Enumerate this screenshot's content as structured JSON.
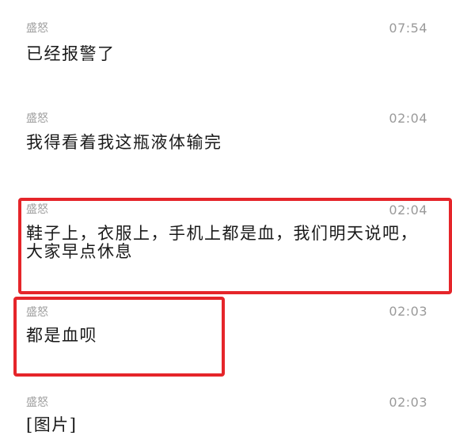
{
  "messages": [
    {
      "sender": "盛怒",
      "time": "07:54",
      "text": "已经报警了"
    },
    {
      "sender": "盛怒",
      "time": "02:04",
      "text": "我得看着我这瓶液体输完"
    },
    {
      "sender": "盛怒",
      "time": "02:04",
      "text": "鞋子上，衣服上，手机上都是血，我们明天说吧，大家早点休息"
    },
    {
      "sender": "盛怒",
      "time": "02:03",
      "text": "都是血呗"
    },
    {
      "sender": "盛怒",
      "time": "02:03",
      "text": "[图片]"
    }
  ],
  "highlight_color": "#e5252a"
}
